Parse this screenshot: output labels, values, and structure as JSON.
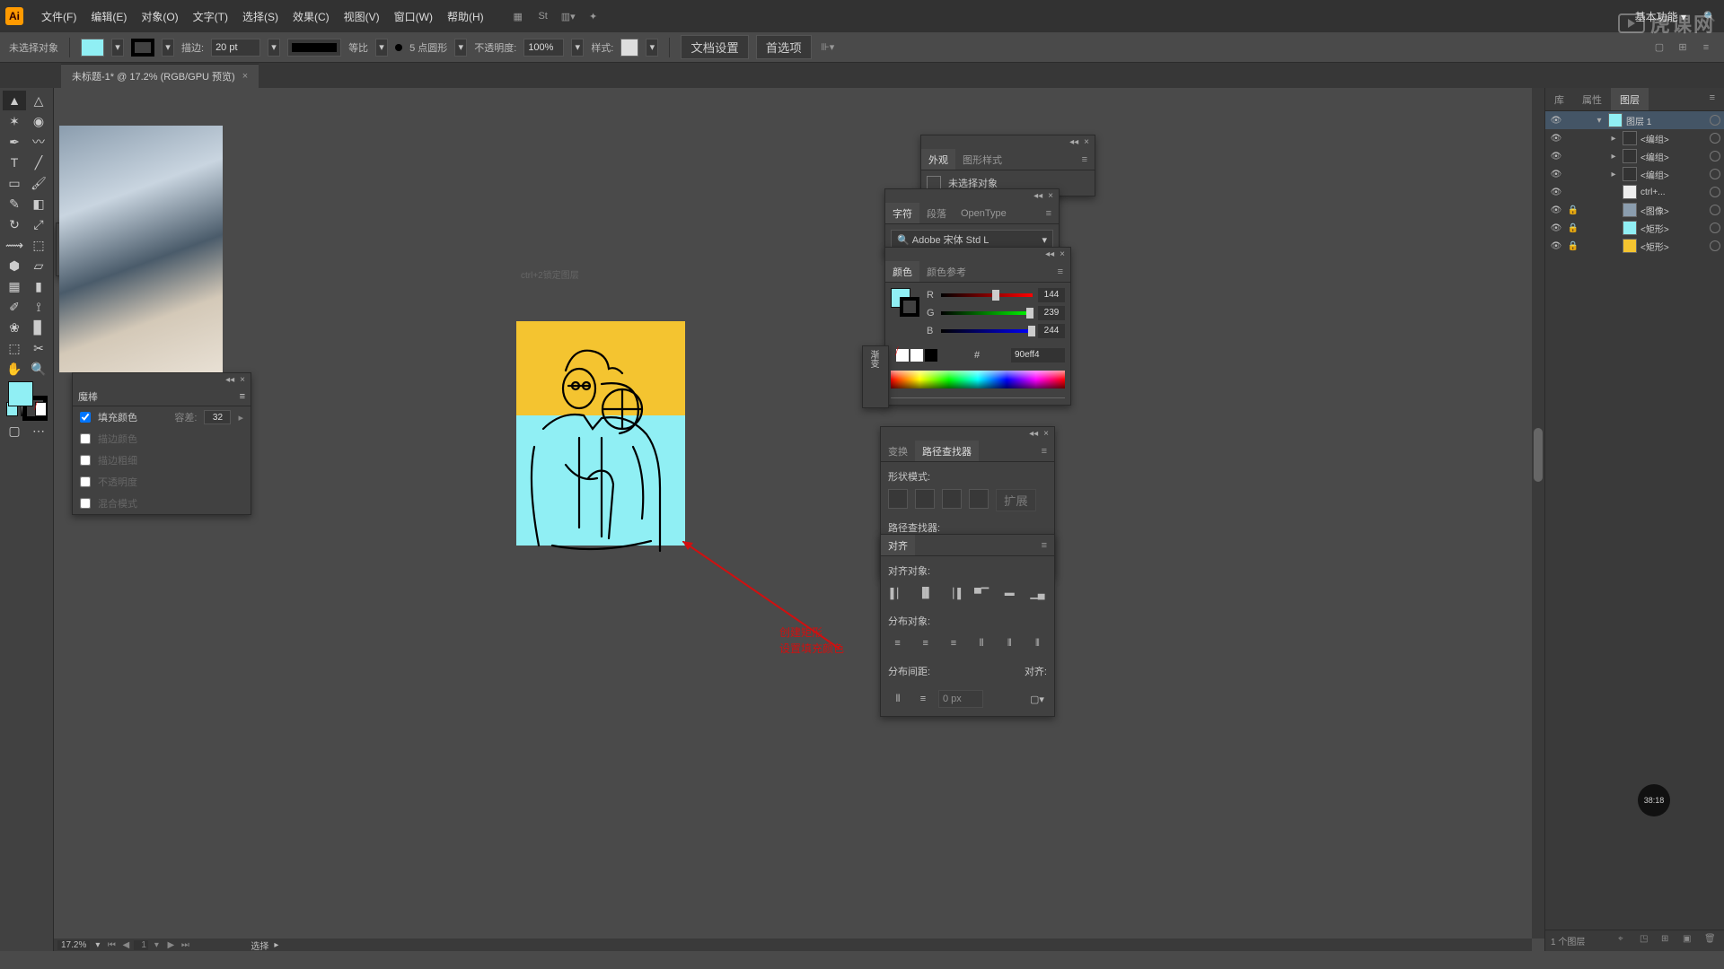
{
  "menubar": {
    "items": [
      "文件(F)",
      "编辑(E)",
      "对象(O)",
      "文字(T)",
      "选择(S)",
      "效果(C)",
      "视图(V)",
      "窗口(W)",
      "帮助(H)"
    ],
    "workspace": "基本功能"
  },
  "controlbar": {
    "selection_label": "未选择对象",
    "stroke_label": "描边:",
    "stroke_weight": "20 pt",
    "stroke_style": "等比",
    "brush_style": "5 点圆形",
    "opacity_label": "不透明度:",
    "opacity_value": "100%",
    "style_label": "样式:",
    "doc_setup": "文档设置",
    "prefs": "首选项"
  },
  "tab": {
    "title": "未标题-1* @ 17.2% (RGB/GPU 预览)"
  },
  "placed_label": "ctrl+2锁定图层",
  "annotation": {
    "line1": "创建矩形",
    "line2": "设置填充颜色"
  },
  "magic": {
    "title": "魔棒",
    "fill_color": "填充颜色",
    "tol_label": "容差:",
    "tol_value": "32",
    "stroke_color": "描边颜色",
    "stroke_weight": "描边粗细",
    "opacity": "不透明度",
    "blend": "混合模式"
  },
  "appearance": {
    "tab1": "外观",
    "tab2": "图形样式",
    "no_sel": "未选择对象"
  },
  "char": {
    "tab1": "字符",
    "tab2": "段落",
    "tab3": "OpenType",
    "font": "Adobe 宋体 Std L"
  },
  "color": {
    "tab1": "颜色",
    "tab2": "颜色参考",
    "r": "R",
    "r_val": "144",
    "g": "G",
    "g_val": "239",
    "b": "B",
    "b_val": "244",
    "hex": "90eff4"
  },
  "gradient": {
    "tab": "渐变"
  },
  "transform": {
    "tab1": "变换",
    "tab2": "路径查找器",
    "shape_modes": "形状模式:",
    "pathfinders": "路径查找器:",
    "expand": "扩展"
  },
  "align": {
    "tab": "对齐",
    "align_objects": "对齐对象:",
    "distribute": "分布对象:",
    "spacing": "分布间距:",
    "align_to": "对齐:",
    "spacing_val": "0 px"
  },
  "layers": {
    "tab1": "库",
    "tab2": "属性",
    "tab3": "图层",
    "items": [
      {
        "name": "图层 1",
        "level": 0,
        "open": true,
        "thumb": "#90eff4",
        "sel": true
      },
      {
        "name": "<编组>",
        "level": 1,
        "thumb": "#333"
      },
      {
        "name": "<编组>",
        "level": 1,
        "thumb": "#333"
      },
      {
        "name": "<编组>",
        "level": 1,
        "thumb": "#333"
      },
      {
        "name": "ctrl+...",
        "level": 1,
        "thumb": "#eee"
      },
      {
        "name": "<图像>",
        "level": 1,
        "thumb": "#8b9dae",
        "locked": true
      },
      {
        "name": "<矩形>",
        "level": 1,
        "thumb": "#90eff4",
        "locked": true
      },
      {
        "name": "<矩形>",
        "level": 1,
        "thumb": "#f4c430",
        "locked": true
      }
    ],
    "footer": "1 个图层"
  },
  "status": {
    "zoom": "17.2%",
    "page": "1",
    "mode": "选择"
  },
  "timer": "38:18",
  "watermark": "虎课网"
}
